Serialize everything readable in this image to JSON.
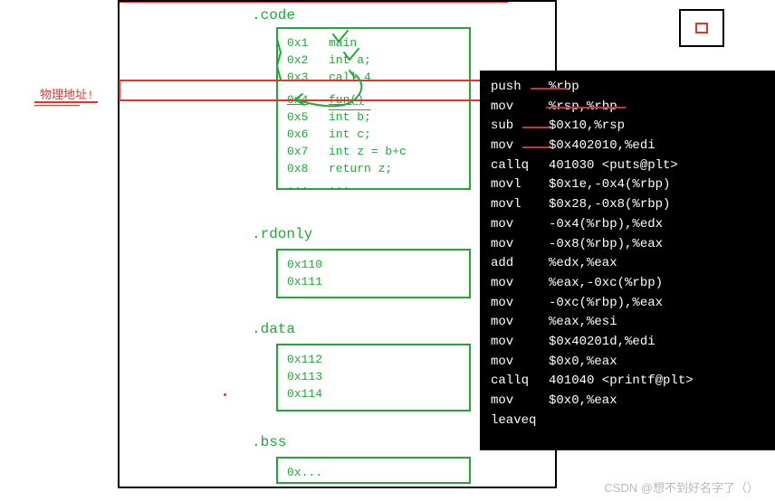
{
  "annotations": {
    "physical_address_label": "物理地址!",
    "watermark": "CSDN @想不到好名字了（）"
  },
  "sections": {
    "code": {
      "label": ".code"
    },
    "rdonly": {
      "label": ".rdonly"
    },
    "data": {
      "label": ".data"
    },
    "bss": {
      "label": ".bss"
    }
  },
  "code_rows": [
    {
      "addr": "0x1",
      "instr": "main"
    },
    {
      "addr": "0x2",
      "instr": "int a;"
    },
    {
      "addr": "0x3",
      "instr": "call 4"
    },
    {
      "addr": "0x4",
      "instr": "fun()"
    },
    {
      "addr": "0x5",
      "instr": "int b;"
    },
    {
      "addr": "0x6",
      "instr": "int c;"
    },
    {
      "addr": "0x7",
      "instr": "int z = b+c"
    },
    {
      "addr": "0x8",
      "instr": "return z;"
    },
    {
      "addr": "...",
      "instr": "..."
    }
  ],
  "rdonly_rows": [
    {
      "addr": "0x110"
    },
    {
      "addr": "0x111"
    }
  ],
  "data_rows": [
    {
      "addr": "0x112"
    },
    {
      "addr": "0x113"
    },
    {
      "addr": "0x114"
    }
  ],
  "bss_rows": [
    {
      "addr": "0x..."
    }
  ],
  "asm": [
    {
      "op": "push",
      "arg": "%rbp"
    },
    {
      "op": "mov",
      "arg": "%rsp,%rbp"
    },
    {
      "op": "sub",
      "arg": "$0x10,%rsp"
    },
    {
      "op": "mov",
      "arg": "$0x402010,%edi"
    },
    {
      "op": "callq",
      "arg": "401030 <puts@plt>"
    },
    {
      "op": "movl",
      "arg": "$0x1e,-0x4(%rbp)"
    },
    {
      "op": "movl",
      "arg": "$0x28,-0x8(%rbp)"
    },
    {
      "op": "mov",
      "arg": "-0x4(%rbp),%edx"
    },
    {
      "op": "mov",
      "arg": "-0x8(%rbp),%eax"
    },
    {
      "op": "add",
      "arg": "%edx,%eax"
    },
    {
      "op": "mov",
      "arg": "%eax,-0xc(%rbp)"
    },
    {
      "op": "mov",
      "arg": "-0xc(%rbp),%eax"
    },
    {
      "op": "mov",
      "arg": "%eax,%esi"
    },
    {
      "op": "mov",
      "arg": "$0x40201d,%edi"
    },
    {
      "op": "mov",
      "arg": "$0x0,%eax"
    },
    {
      "op": "callq",
      "arg": "401040 <printf@plt>"
    },
    {
      "op": "mov",
      "arg": "$0x0,%eax"
    },
    {
      "op": "leaveq",
      "arg": ""
    }
  ]
}
